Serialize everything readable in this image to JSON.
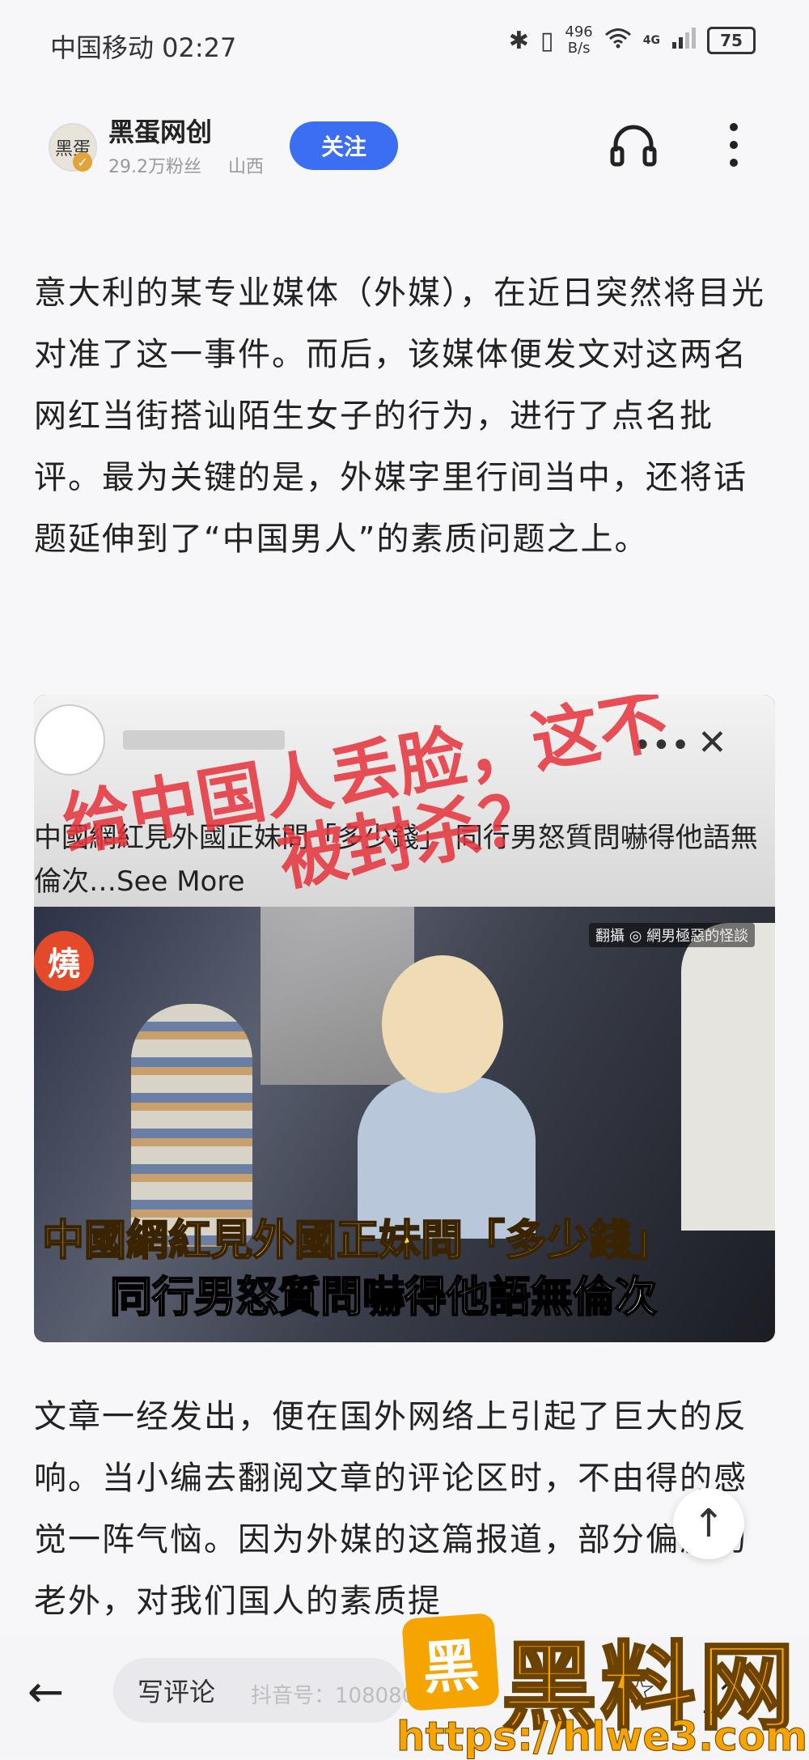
{
  "status_bar": {
    "carrier_time": "中国移动 02:27",
    "net_speed_value": "496",
    "net_speed_unit": "B/s",
    "network_type": "4G",
    "battery": "75"
  },
  "header": {
    "author_name": "黑蛋网创",
    "followers": "29.2万粉丝",
    "location": "山西",
    "follow_label": "关注",
    "avatar_text": "黑蛋"
  },
  "article": {
    "para1": "意大利的某专业媒体（外媒），在近日突然将目光对准了这一事件。而后，该媒体便发文对这两名网红当街搭讪陌生女子的行为，进行了点名批评。最为关键的是，外媒字里行间当中，还将话题延伸到了“中国男人”的素质问题之上。",
    "para2": "文章一经发出，便在国外网络上引起了巨大的反响。当小编去翻阅文章的评论区时，不由得的感觉一阵气恼。因为外媒的这篇报道，部分偏激的老外，对我们国人的素质提"
  },
  "embedded_post": {
    "caption": "中國網紅見外國正妹問「多少錢」  同行男怒質問嚇得他語無倫次…See More",
    "overlay_line1": "给中国人丢脸，这不",
    "overlay_line2": "被封杀？",
    "badge": "燒",
    "video_tag": "翻攝 ◎ 網男極惡的怪談",
    "video_title1": "中國網紅見外國正妹問「多少錢」",
    "video_title2": "同行男怒質問嚇得他語無倫次"
  },
  "bottom_bar": {
    "comment_placeholder": "写评论",
    "douyin_mark": "抖音号：1080805"
  },
  "watermark": {
    "logo_char": "黑",
    "text": "黑料网",
    "url": "https://hlwe3.com"
  },
  "colors": {
    "accent": "#3b6ef2",
    "overlay_red": "#e6323a",
    "watermark_orange": "#f5a400"
  }
}
